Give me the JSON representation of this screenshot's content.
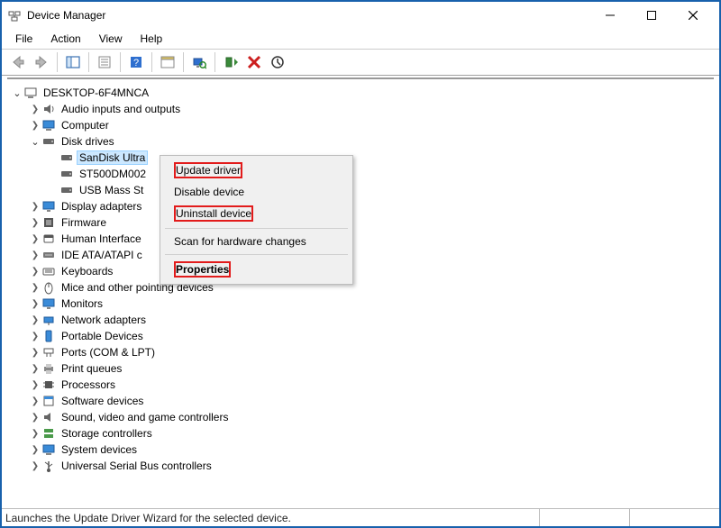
{
  "window": {
    "title": "Device Manager"
  },
  "menu": {
    "file": "File",
    "action": "Action",
    "view": "View",
    "help": "Help"
  },
  "tree": {
    "root": "DESKTOP-6F4MNCA",
    "categories": {
      "audio": "Audio inputs and outputs",
      "computer": "Computer",
      "disk_drives": "Disk drives",
      "display": "Display adapters",
      "firmware": "Firmware",
      "hid": "Human Interface",
      "ide": "IDE ATA/ATAPI c",
      "keyboards": "Keyboards",
      "mice": "Mice and other pointing devices",
      "monitors": "Monitors",
      "network": "Network adapters",
      "portable": "Portable Devices",
      "ports": "Ports (COM & LPT)",
      "print_queues": "Print queues",
      "processors": "Processors",
      "software": "Software devices",
      "sound": "Sound, video and game controllers",
      "storage": "Storage controllers",
      "system": "System devices",
      "usb": "Universal Serial Bus controllers"
    },
    "disk_drive_children": {
      "sandisk": "SanDisk Ultra",
      "st500": "ST500DM002",
      "usb_mass": "USB Mass St"
    }
  },
  "context_menu": {
    "update_driver": "Update driver",
    "disable": "Disable device",
    "uninstall": "Uninstall device",
    "scan": "Scan for hardware changes",
    "properties": "Properties"
  },
  "status": {
    "text": "Launches the Update Driver Wizard for the selected device."
  }
}
